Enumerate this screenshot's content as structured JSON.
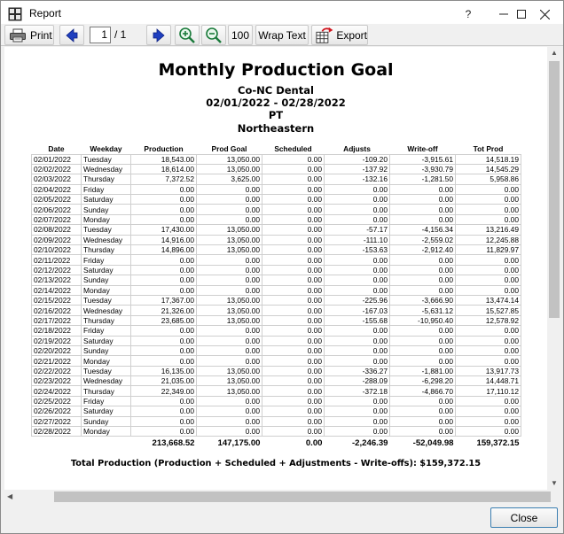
{
  "window": {
    "title": "Report",
    "help_label": "?",
    "minimize_label": "—",
    "maximize_label": "☐",
    "close_label": "✕"
  },
  "toolbar": {
    "print_label": "Print",
    "page_current": "1",
    "page_total": "/ 1",
    "zoom_reset_label": "100",
    "wrap_text_label": "Wrap Text",
    "export_label": "Export",
    "icons": [
      "printer-icon",
      "arrow-left-icon",
      "arrow-right-icon",
      "zoom-in-icon",
      "zoom-out-icon",
      "export-icon"
    ]
  },
  "report": {
    "title": "Monthly Production Goal",
    "practice": "Co-NC Dental",
    "date_range": "02/01/2022 - 02/28/2022",
    "provider": "PT",
    "clinic": "Northeastern",
    "columns": [
      "Date",
      "Weekday",
      "Production",
      "Prod Goal",
      "Scheduled",
      "Adjusts",
      "Write-off",
      "Tot Prod"
    ],
    "rows": [
      [
        "02/01/2022",
        "Tuesday",
        "18,543.00",
        "13,050.00",
        "0.00",
        "-109.20",
        "-3,915.61",
        "14,518.19"
      ],
      [
        "02/02/2022",
        "Wednesday",
        "18,614.00",
        "13,050.00",
        "0.00",
        "-137.92",
        "-3,930.79",
        "14,545.29"
      ],
      [
        "02/03/2022",
        "Thursday",
        "7,372.52",
        "3,625.00",
        "0.00",
        "-132.16",
        "-1,281.50",
        "5,958.86"
      ],
      [
        "02/04/2022",
        "Friday",
        "0.00",
        "0.00",
        "0.00",
        "0.00",
        "0.00",
        "0.00"
      ],
      [
        "02/05/2022",
        "Saturday",
        "0.00",
        "0.00",
        "0.00",
        "0.00",
        "0.00",
        "0.00"
      ],
      [
        "02/06/2022",
        "Sunday",
        "0.00",
        "0.00",
        "0.00",
        "0.00",
        "0.00",
        "0.00"
      ],
      [
        "02/07/2022",
        "Monday",
        "0.00",
        "0.00",
        "0.00",
        "0.00",
        "0.00",
        "0.00"
      ],
      [
        "02/08/2022",
        "Tuesday",
        "17,430.00",
        "13,050.00",
        "0.00",
        "-57.17",
        "-4,156.34",
        "13,216.49"
      ],
      [
        "02/09/2022",
        "Wednesday",
        "14,916.00",
        "13,050.00",
        "0.00",
        "-111.10",
        "-2,559.02",
        "12,245.88"
      ],
      [
        "02/10/2022",
        "Thursday",
        "14,896.00",
        "13,050.00",
        "0.00",
        "-153.63",
        "-2,912.40",
        "11,829.97"
      ],
      [
        "02/11/2022",
        "Friday",
        "0.00",
        "0.00",
        "0.00",
        "0.00",
        "0.00",
        "0.00"
      ],
      [
        "02/12/2022",
        "Saturday",
        "0.00",
        "0.00",
        "0.00",
        "0.00",
        "0.00",
        "0.00"
      ],
      [
        "02/13/2022",
        "Sunday",
        "0.00",
        "0.00",
        "0.00",
        "0.00",
        "0.00",
        "0.00"
      ],
      [
        "02/14/2022",
        "Monday",
        "0.00",
        "0.00",
        "0.00",
        "0.00",
        "0.00",
        "0.00"
      ],
      [
        "02/15/2022",
        "Tuesday",
        "17,367.00",
        "13,050.00",
        "0.00",
        "-225.96",
        "-3,666.90",
        "13,474.14"
      ],
      [
        "02/16/2022",
        "Wednesday",
        "21,326.00",
        "13,050.00",
        "0.00",
        "-167.03",
        "-5,631.12",
        "15,527.85"
      ],
      [
        "02/17/2022",
        "Thursday",
        "23,685.00",
        "13,050.00",
        "0.00",
        "-155.68",
        "-10,950.40",
        "12,578.92"
      ],
      [
        "02/18/2022",
        "Friday",
        "0.00",
        "0.00",
        "0.00",
        "0.00",
        "0.00",
        "0.00"
      ],
      [
        "02/19/2022",
        "Saturday",
        "0.00",
        "0.00",
        "0.00",
        "0.00",
        "0.00",
        "0.00"
      ],
      [
        "02/20/2022",
        "Sunday",
        "0.00",
        "0.00",
        "0.00",
        "0.00",
        "0.00",
        "0.00"
      ],
      [
        "02/21/2022",
        "Monday",
        "0.00",
        "0.00",
        "0.00",
        "0.00",
        "0.00",
        "0.00"
      ],
      [
        "02/22/2022",
        "Tuesday",
        "16,135.00",
        "13,050.00",
        "0.00",
        "-336.27",
        "-1,881.00",
        "13,917.73"
      ],
      [
        "02/23/2022",
        "Wednesday",
        "21,035.00",
        "13,050.00",
        "0.00",
        "-288.09",
        "-6,298.20",
        "14,448.71"
      ],
      [
        "02/24/2022",
        "Thursday",
        "22,349.00",
        "13,050.00",
        "0.00",
        "-372.18",
        "-4,866.70",
        "17,110.12"
      ],
      [
        "02/25/2022",
        "Friday",
        "0.00",
        "0.00",
        "0.00",
        "0.00",
        "0.00",
        "0.00"
      ],
      [
        "02/26/2022",
        "Saturday",
        "0.00",
        "0.00",
        "0.00",
        "0.00",
        "0.00",
        "0.00"
      ],
      [
        "02/27/2022",
        "Sunday",
        "0.00",
        "0.00",
        "0.00",
        "0.00",
        "0.00",
        "0.00"
      ],
      [
        "02/28/2022",
        "Monday",
        "0.00",
        "0.00",
        "0.00",
        "0.00",
        "0.00",
        "0.00"
      ]
    ],
    "totals": [
      "",
      "",
      "213,668.52",
      "147,175.00",
      "0.00",
      "-2,246.39",
      "-52,049.98",
      "159,372.15"
    ],
    "grand_total_text": "Total Production (Production + Scheduled + Adjustments - Write-offs): $159,372.15"
  },
  "footer": {
    "close_label": "Close"
  },
  "colors": {
    "nav_arrow": "#1f3fbf",
    "zoom_icon": "#1a7a3a",
    "close_border": "#3c7fb1"
  }
}
